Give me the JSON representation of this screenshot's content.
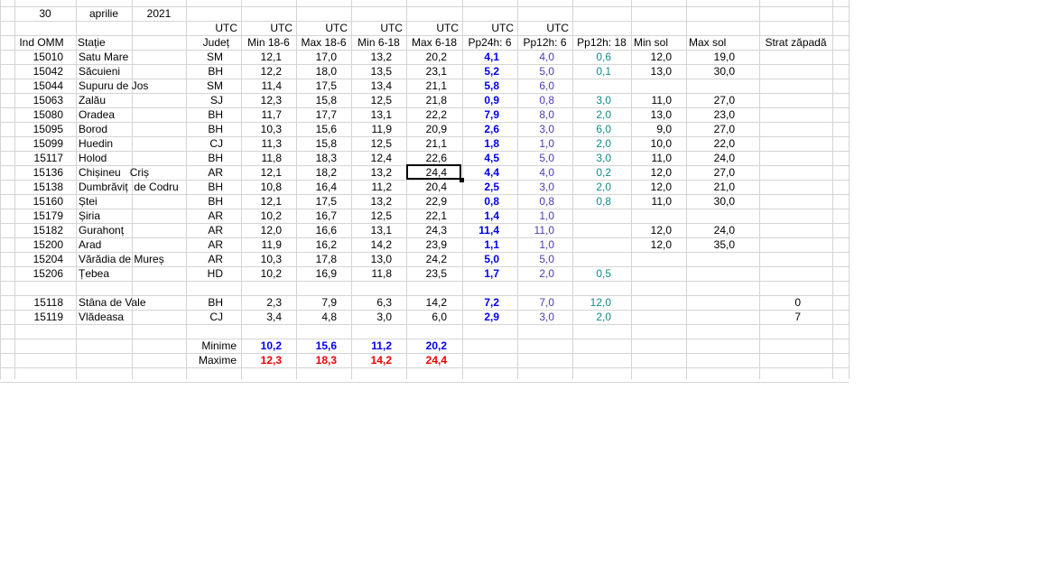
{
  "header": {
    "day": "30",
    "month": "aprilie",
    "year": "2021"
  },
  "utc_row": [
    "UTC",
    "UTC",
    "UTC",
    "UTC",
    "UTC",
    "UTC",
    "UTC"
  ],
  "columns": [
    "Ind OMM",
    "Stație",
    "Județ",
    "Min 18-6",
    "Max 18-6",
    "Min 6-18",
    "Max 6-18",
    "Pp24h: 6",
    "Pp12h: 6",
    "Pp12h: 18",
    "Min sol",
    "Max sol",
    "Strat zăpadă"
  ],
  "rows": [
    [
      "15010",
      "Satu Mare",
      "SM",
      "12,1",
      "17,0",
      "13,2",
      "20,2",
      "4,1",
      "4,0",
      "0,6",
      "12,0",
      "19,0",
      ""
    ],
    [
      "15042",
      "Săcuieni",
      "BH",
      "12,2",
      "18,0",
      "13,5",
      "23,1",
      "5,2",
      "5,0",
      "0,1",
      "13,0",
      "30,0",
      ""
    ],
    [
      "15044",
      "Supuru de Jos",
      "SM",
      "11,4",
      "17,5",
      "13,4",
      "21,1",
      "5,8",
      "6,0",
      "",
      "",
      "",
      ""
    ],
    [
      "15063",
      "Zalău",
      "SJ",
      "12,3",
      "15,8",
      "12,5",
      "21,8",
      "0,9",
      "0,8",
      "3,0",
      "11,0",
      "27,0",
      ""
    ],
    [
      "15080",
      "Oradea",
      "BH",
      "11,7",
      "17,7",
      "13,1",
      "22,2",
      "7,9",
      "8,0",
      "2,0",
      "13,0",
      "23,0",
      ""
    ],
    [
      "15095",
      "Borod",
      "BH",
      "10,3",
      "15,6",
      "11,9",
      "20,9",
      "2,6",
      "3,0",
      "6,0",
      "9,0",
      "27,0",
      ""
    ],
    [
      "15099",
      "Huedin",
      "CJ",
      "11,3",
      "15,8",
      "12,5",
      "21,1",
      "1,8",
      "1,0",
      "2,0",
      "10,0",
      "22,0",
      ""
    ],
    [
      "15117",
      "Holod",
      "BH",
      "11,8",
      "18,3",
      "12,4",
      "22,6",
      "4,5",
      "5,0",
      "3,0",
      "11,0",
      "24,0",
      ""
    ],
    [
      "15136",
      "Chișineu   Criș",
      "AR",
      "12,1",
      "18,2",
      "13,2",
      "24,4",
      "4,4",
      "4,0",
      "0,2",
      "12,0",
      "27,0",
      ""
    ],
    [
      "15138",
      "Dumbrăviț  de Codru",
      "BH",
      "10,8",
      "16,4",
      "11,2",
      "20,4",
      "2,5",
      "3,0",
      "2,0",
      "12,0",
      "21,0",
      ""
    ],
    [
      "15160",
      "Ștei",
      "BH",
      "12,1",
      "17,5",
      "13,2",
      "22,9",
      "0,8",
      "0,8",
      "0,8",
      "11,0",
      "30,0",
      ""
    ],
    [
      "15179",
      "Șiria",
      "AR",
      "10,2",
      "16,7",
      "12,5",
      "22,1",
      "1,4",
      "1,0",
      "",
      "",
      "",
      ""
    ],
    [
      "15182",
      "Gurahonț",
      "AR",
      "12,0",
      "16,6",
      "13,1",
      "24,3",
      "11,4",
      "11,0",
      "",
      "12,0",
      "24,0",
      ""
    ],
    [
      "15200",
      "Arad",
      "AR",
      "11,9",
      "16,2",
      "14,2",
      "23,9",
      "1,1",
      "1,0",
      "",
      "12,0",
      "35,0",
      ""
    ],
    [
      "15204",
      "Vărădia de Mureș",
      "AR",
      "10,3",
      "17,8",
      "13,0",
      "24,2",
      "5,0",
      "5,0",
      "",
      "",
      "",
      ""
    ],
    [
      "15206",
      "Țebea",
      "HD",
      "10,2",
      "16,9",
      "11,8",
      "23,5",
      "1,7",
      "2,0",
      "0,5",
      "",
      "",
      ""
    ],
    [
      "",
      "",
      "",
      "",
      "",
      "",
      "",
      "",
      "",
      "",
      "",
      "",
      ""
    ],
    [
      "15118",
      "Stâna de Vale",
      "BH",
      "2,3",
      "7,9",
      "6,3",
      "14,2",
      "7,2",
      "7,0",
      "12,0",
      "",
      "",
      "0"
    ],
    [
      "15119",
      "Vlădeasa",
      "CJ",
      "3,4",
      "4,8",
      "3,0",
      "6,0",
      "2,9",
      "3,0",
      "2,0",
      "",
      "",
      "7"
    ]
  ],
  "summary": {
    "min_label": "Minime",
    "max_label": "Maxime",
    "min": [
      "10,2",
      "15,6",
      "11,2",
      "20,2"
    ],
    "max": [
      "12,3",
      "18,3",
      "14,2",
      "24,4"
    ]
  },
  "selected_cell": {
    "row": "15136",
    "column": "Max 6-18",
    "value": "24,4"
  },
  "colors": {
    "pp24": "#0000ee",
    "pp12_6": "#4b3db3",
    "pp12_18": "#138a8a",
    "minime": "#0000ee",
    "maxime": "#ee0000",
    "grid": "#d4d4d4"
  }
}
